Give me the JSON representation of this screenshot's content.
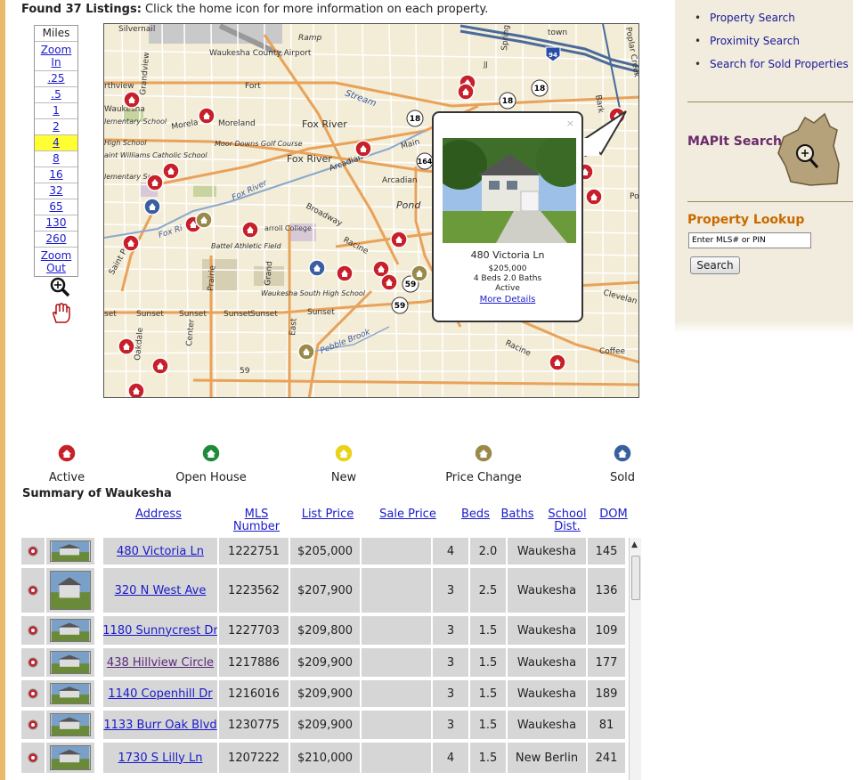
{
  "header": {
    "found_label": "Found 37 Listings:",
    "found_text": " Click the home icon for more information on each property."
  },
  "zoom": {
    "header": "Miles",
    "zoom_in": "Zoom In",
    "levels": [
      ".25",
      ".5",
      "1",
      "2",
      "4",
      "8",
      "16",
      "32",
      "65",
      "130",
      "260"
    ],
    "selected": "4",
    "zoom_out": "Zoom Out"
  },
  "map": {
    "labels": {
      "silvernail": "Silvernail",
      "airport": "Waukesha County Airport",
      "fort": "Fort",
      "ramp": "Ramp",
      "stream": "Stream",
      "fox_river_1": "Fox River",
      "fox_river_2": "Fox River",
      "fox_river_3": "Fox River",
      "fox_ri": "Fox Ri",
      "moreland": "Moreland",
      "morela": "Morela",
      "moor_downs": "Moor Downs Golf Course",
      "main": "Main",
      "arcadian": "Arcadian",
      "arcadian2": "Arcadian",
      "pond": "Pond",
      "broadway": "Broadway",
      "racine": "Racine",
      "racine2": "Racine",
      "carroll": "arroll College",
      "battel": "Battel Athletic Field",
      "south_hs": "Waukesha South High School",
      "sunset1": "Sunset",
      "sunset2": "Sunset",
      "sunset3": "Sunset",
      "sunset4": "Sunset",
      "sunset5": "Sunset",
      "pebble": "Pebble Brook",
      "cleveland": "Clevelan",
      "coffee": "Coffee",
      "grandview": "Grandview",
      "prairie": "Prairie",
      "grand": "Grand",
      "east": "East",
      "center": "Center",
      "oakdale": "Oakdale",
      "saint_paul": "Saint Paul",
      "northview": "rthview",
      "waukesha_small": "Waukesha",
      "elementary1": "lementary School",
      "high_school": "High School",
      "st_williams": "aint Williams Catholic School",
      "elementary2": "lementary Sch",
      "spring": "Spring",
      "town": "town",
      "poplar_creek": "Poplar Creek",
      "bark": "Bark",
      "eek": "eek",
      "po": "Po",
      "set": "set",
      "r59": "59",
      "jj": "JJ",
      "route18a": "18",
      "route18b": "18",
      "route18c": "18",
      "route164": "164",
      "route59a": "59",
      "route59b": "59",
      "route94": "94"
    },
    "popup": {
      "address": "480 Victoria Ln",
      "price": "$205,000",
      "beds_baths": "4 Beds 2.0 Baths",
      "status": "Active",
      "more": "More Details",
      "close": "×"
    }
  },
  "legend": [
    {
      "label": "Active",
      "color": "#c8202a"
    },
    {
      "label": "Open House",
      "color": "#1f8a3a"
    },
    {
      "label": "New",
      "color": "#e8d21a"
    },
    {
      "label": "Price Change",
      "color": "#9a8a4a"
    },
    {
      "label": "Sold",
      "color": "#3a5fa0"
    }
  ],
  "summary_title": "Summary of Waukesha",
  "table": {
    "headers": {
      "address": "Address",
      "mls": "MLS Number",
      "list_price": "List Price",
      "sale_price": "Sale Price",
      "beds": "Beds",
      "baths": "Baths",
      "school1": "School",
      "school2": "Dist.",
      "dom": "DOM"
    },
    "rows": [
      {
        "address": "480 Victoria Ln",
        "mls": "1222751",
        "list_price": "$205,000",
        "sale_price": "",
        "beds": "4",
        "baths": "2.0",
        "school": "Waukesha",
        "dom": "145",
        "visited": false
      },
      {
        "address": "320 N West Ave",
        "mls": "1223562",
        "list_price": "$207,900",
        "sale_price": "",
        "beds": "3",
        "baths": "2.5",
        "school": "Waukesha",
        "dom": "136",
        "visited": false
      },
      {
        "address": "1180 Sunnycrest Dr",
        "mls": "1227703",
        "list_price": "$209,800",
        "sale_price": "",
        "beds": "3",
        "baths": "1.5",
        "school": "Waukesha",
        "dom": "109",
        "visited": false
      },
      {
        "address": "438 Hillview Circle",
        "mls": "1217886",
        "list_price": "$209,900",
        "sale_price": "",
        "beds": "3",
        "baths": "1.5",
        "school": "Waukesha",
        "dom": "177",
        "visited": true
      },
      {
        "address": "1140 Copenhill Dr",
        "mls": "1216016",
        "list_price": "$209,900",
        "sale_price": "",
        "beds": "3",
        "baths": "1.5",
        "school": "Waukesha",
        "dom": "189",
        "visited": false
      },
      {
        "address": "1133 Burr Oak Blvd",
        "mls": "1230775",
        "list_price": "$209,900",
        "sale_price": "",
        "beds": "3",
        "baths": "1.5",
        "school": "Waukesha",
        "dom": "81",
        "visited": false
      },
      {
        "address": "1730 S Lilly Ln",
        "mls": "1207222",
        "list_price": "$210,000",
        "sale_price": "",
        "beds": "4",
        "baths": "1.5",
        "school": "New Berlin",
        "dom": "241",
        "visited": false
      }
    ]
  },
  "sidebar": {
    "links": [
      "Property Search",
      "Proximity Search",
      "Search for Sold Properties"
    ],
    "mapit_label": "MAPIt Search",
    "lookup_title": "Property Lookup",
    "lookup_placeholder": "Enter MLS# or PIN",
    "search_button": "Search"
  }
}
